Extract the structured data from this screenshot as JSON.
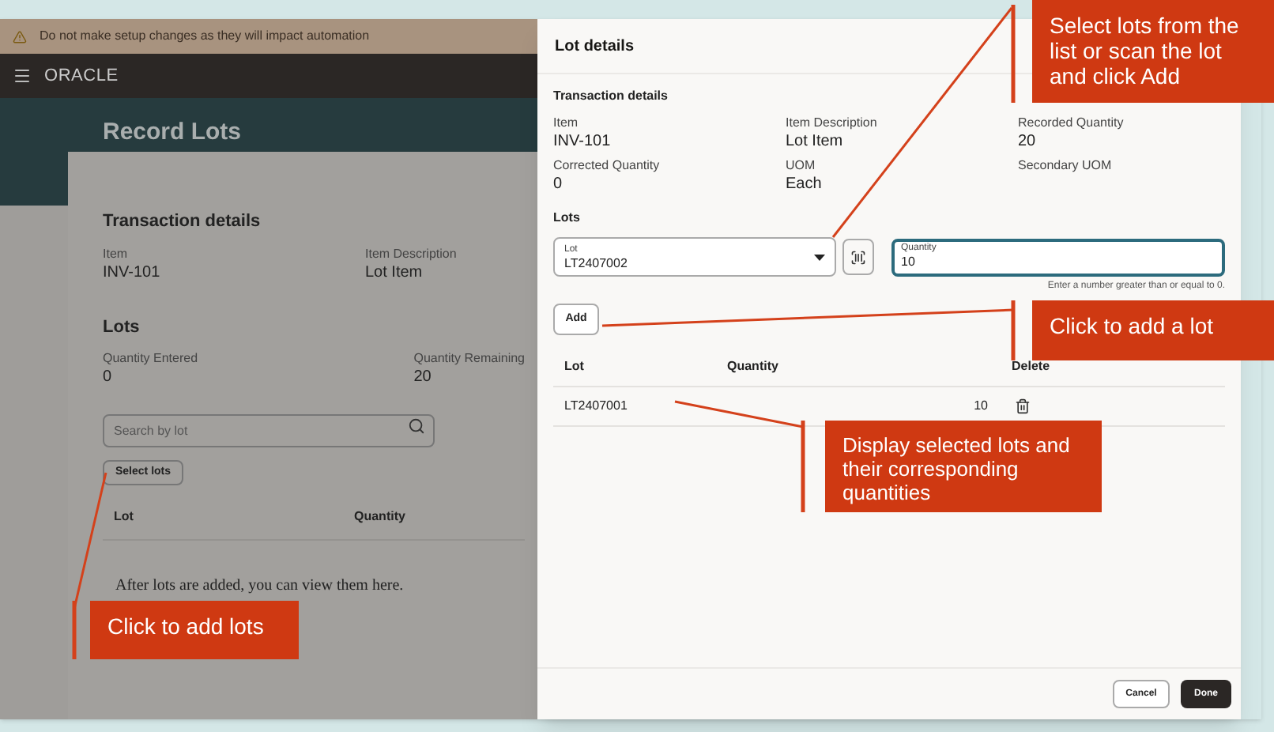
{
  "banner": {
    "text": "Do not make setup changes as they will impact automation"
  },
  "navbar": {
    "logo": "ORACLE"
  },
  "page": {
    "title": "Record Lots",
    "transaction": {
      "heading": "Transaction details",
      "fields": [
        {
          "label": "Item",
          "value": "INV-101"
        },
        {
          "label": "Item Description",
          "value": "Lot Item"
        }
      ]
    },
    "lots": {
      "heading": "Lots",
      "fields": [
        {
          "label": "Quantity Entered",
          "value": "0"
        },
        {
          "label": "Quantity Remaining",
          "value": "20"
        }
      ],
      "search": {
        "placeholder": "Search by lot"
      },
      "button": "Select lots",
      "columns": [
        "Lot",
        "Quantity"
      ],
      "empty_message": "After lots are added, you can view them here."
    }
  },
  "drawer": {
    "title": "Lot details",
    "transaction": {
      "heading": "Transaction details",
      "fields": [
        {
          "label": "Item",
          "value": "INV-101"
        },
        {
          "label": "Item Description",
          "value": "Lot Item"
        },
        {
          "label": "Recorded Quantity",
          "value": "20"
        },
        {
          "label": "Corrected Quantity",
          "value": "0"
        },
        {
          "label": "UOM",
          "value": "Each"
        },
        {
          "label": "Secondary UOM"
        }
      ]
    },
    "lots": {
      "heading": "Lots",
      "lot_field": {
        "label": "Lot",
        "value": "LT2407002"
      },
      "quantity_field": {
        "label": "Quantity",
        "value": "10",
        "hint": "Enter a number greater than or equal to 0."
      },
      "add_button": "Add",
      "columns": [
        "Lot",
        "Quantity",
        "Delete"
      ],
      "rows": [
        {
          "lot": "LT2407001",
          "quantity": "10"
        }
      ]
    },
    "buttons": {
      "cancel": "Cancel",
      "done": "Done"
    }
  },
  "callouts": [
    {
      "text": "Select lots from the list  or scan the lot and click  Add"
    },
    {
      "text": "Click to add a lot"
    },
    {
      "text": "Display selected lots and their corresponding quantities"
    },
    {
      "text": "Click to add lots"
    }
  ]
}
